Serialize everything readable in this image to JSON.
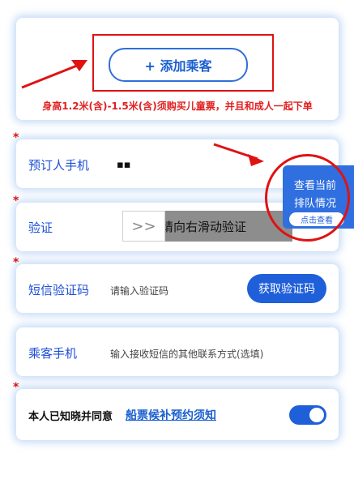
{
  "passenger_card": {
    "add_button_label": "+ 添加乘客",
    "child_ticket_notice": "身高1.2米(含)-1.5米(含)须购买儿童票，并且和成人一起下单"
  },
  "booker_phone": {
    "label": "预订人手机",
    "value": "▪▪"
  },
  "verify": {
    "label": "验证",
    "slider_text": "请向右滑动验证",
    "handle_glyph": ">>"
  },
  "sms_code": {
    "label": "短信验证码",
    "placeholder": "请输入验证码",
    "button_label": "获取验证码"
  },
  "passenger_phone": {
    "label": "乘客手机",
    "placeholder": "输入接收短信的其他联系方式(选填)"
  },
  "agreement": {
    "prefix": "本人已知晓并同意",
    "link": "船票候补预约须知",
    "toggle_on": true
  },
  "queue_widget": {
    "line1": "查看当前",
    "line2": "排队情况",
    "button_label": "点击查看"
  },
  "required_mark": "*",
  "colors": {
    "primary": "#1f5fd9",
    "annotation_red": "#e01212",
    "notice_red": "#e01f1f"
  }
}
